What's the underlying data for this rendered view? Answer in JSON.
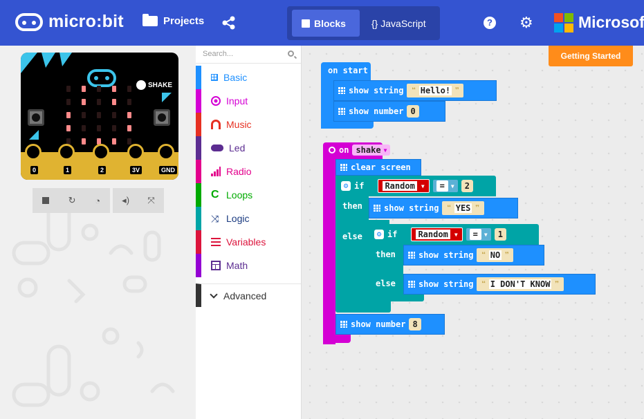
{
  "app": {
    "brand": "micro:bit",
    "projects_label": "Projects",
    "blocks_label": "Blocks",
    "javascript_label": "{} JavaScript",
    "microsoft_label": "Microsoft",
    "help_label": "?"
  },
  "simulator": {
    "shake_label": "SHAKE",
    "pins": [
      "0",
      "1",
      "2",
      "3V",
      "GND"
    ],
    "led_matrix": [
      [
        0,
        1,
        0,
        1,
        0
      ],
      [
        0,
        1,
        0,
        1,
        0
      ],
      [
        1,
        0,
        0,
        0,
        1
      ],
      [
        1,
        0,
        0,
        0,
        1
      ],
      [
        0,
        1,
        1,
        1,
        0
      ]
    ],
    "toolbar_icons": [
      "stop-icon",
      "restart-icon",
      "slowmo-icon",
      "mute-icon",
      "fullscreen-icon"
    ]
  },
  "toolbox": {
    "search_placeholder": "Search...",
    "categories": [
      {
        "label": "Basic",
        "color": "#1e90ff"
      },
      {
        "label": "Input",
        "color": "#d400d4"
      },
      {
        "label": "Music",
        "color": "#e63022"
      },
      {
        "label": "Led",
        "color": "#5c2d91"
      },
      {
        "label": "Radio",
        "color": "#e3008c"
      },
      {
        "label": "Loops",
        "color": "#00aa00"
      },
      {
        "label": "Logic",
        "color": "#00a4a6"
      },
      {
        "label": "Variables",
        "color": "#dc143c"
      },
      {
        "label": "Math",
        "color": "#9400d3"
      }
    ],
    "advanced_label": "Advanced"
  },
  "workspace": {
    "getting_started_label": "Getting Started",
    "on_start": {
      "label": "on start",
      "show_string_label": "show string",
      "hello_value": "Hello!",
      "show_number_label": "show number",
      "number_value": "0"
    },
    "on_shake": {
      "on_label": "on",
      "event": "shake",
      "clear_screen_label": "clear screen",
      "if_label": "if",
      "then_label": "then",
      "else_label": "else",
      "random_label": "Random",
      "eq_label": "=",
      "cond1_value": "2",
      "yes_value": "YES",
      "cond2_value": "1",
      "no_value": "NO",
      "dont_know_value": "I DON'T KNOW",
      "show_string_label": "show string",
      "show_number_label": "show number",
      "final_number": "8"
    },
    "colors": {
      "basic": "#1e90ff",
      "input": "#d400d4",
      "logic": "#00a4a6",
      "random_var": "#dc143c"
    }
  }
}
